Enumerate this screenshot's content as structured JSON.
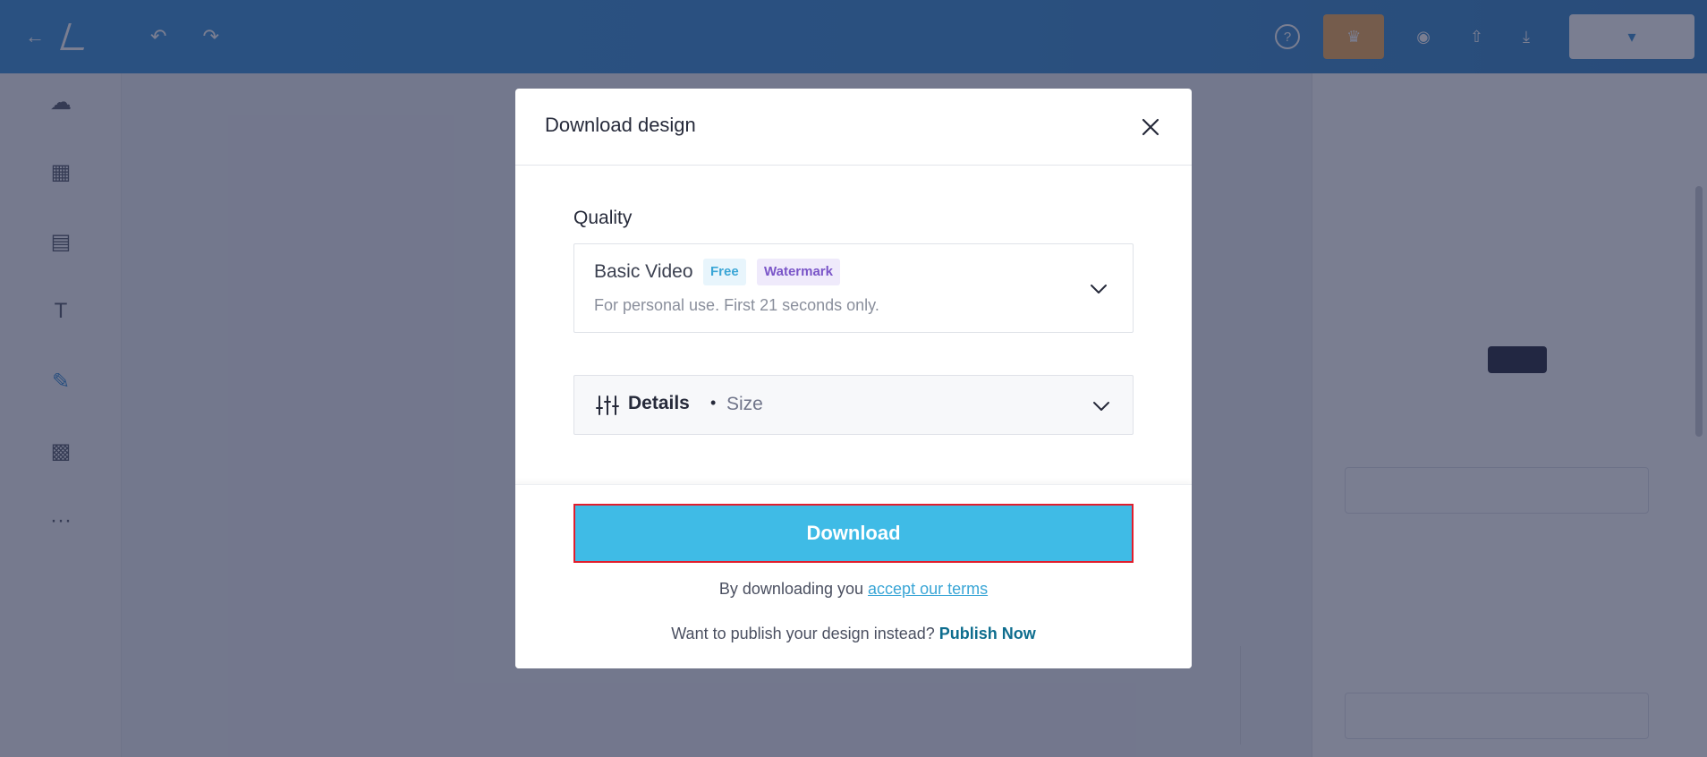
{
  "modal": {
    "title": "Download design",
    "quality_label": "Quality",
    "quality": {
      "name": "Basic Video",
      "badge_free": "Free",
      "badge_watermark": "Watermark",
      "description": "For personal use. First 21 seconds only."
    },
    "details": {
      "label": "Details",
      "separator": "•",
      "size_label": "Size"
    },
    "download_button": "Download",
    "terms_prefix": "By downloading you ",
    "terms_link": "accept our terms",
    "publish_prefix": "Want to publish your design instead? ",
    "publish_link": "Publish Now"
  },
  "colors": {
    "primary_button": "#3fbbe6",
    "highlight_border": "#e01e2d",
    "link": "#3aa6d6",
    "publish_link": "#0e6d8e",
    "topbar": "#2f86cf",
    "upgrade": "#f2a64a"
  },
  "icons": {
    "close": "close-icon",
    "chevron": "chevron-down-icon",
    "details": "sliders-icon"
  }
}
